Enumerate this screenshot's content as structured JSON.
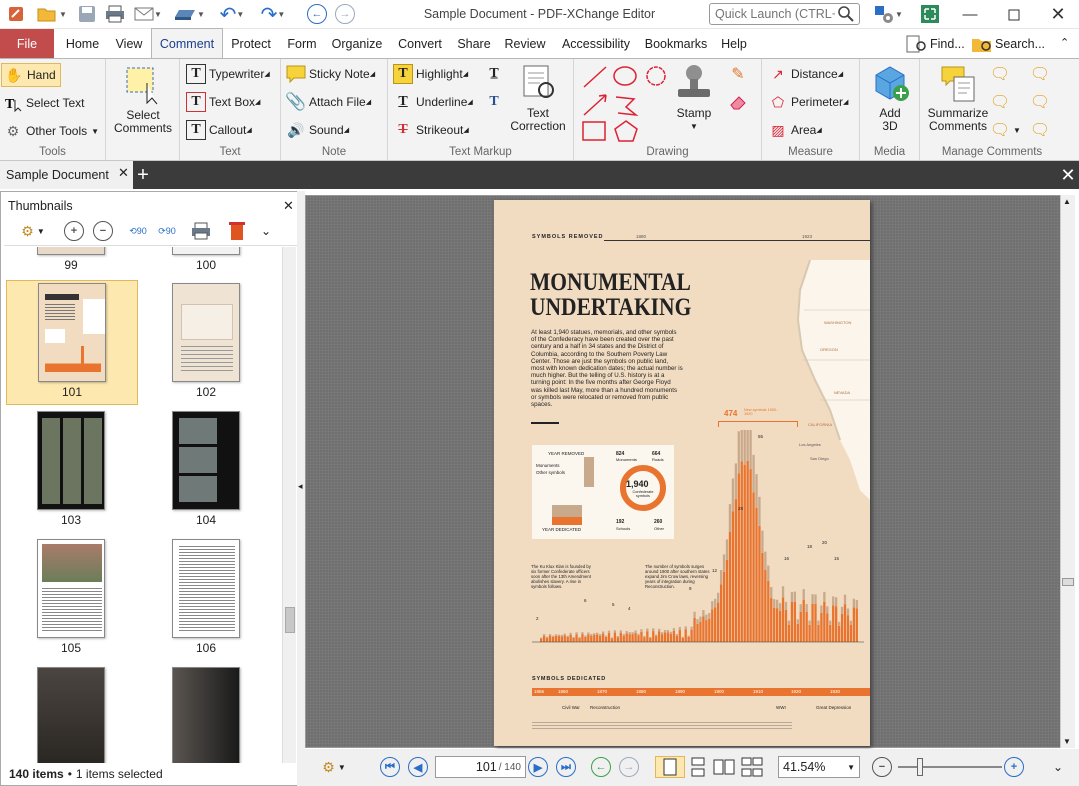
{
  "window": {
    "title": "Sample Document - PDF-XChange Editor",
    "quick_launch_placeholder": "Quick Launch (CTRL+.)"
  },
  "menu": {
    "file": "File",
    "tabs": [
      "Home",
      "View",
      "Comment",
      "Protect",
      "Form",
      "Organize",
      "Convert",
      "Share",
      "Review",
      "Accessibility",
      "Bookmarks",
      "Help"
    ],
    "active_tab": "Comment",
    "find": "Find...",
    "search": "Search..."
  },
  "ribbon": {
    "tools": {
      "label": "Tools",
      "hand": "Hand",
      "select_text": "Select Text",
      "other_tools": "Other Tools"
    },
    "select_comments": {
      "line1": "Select",
      "line2": "Comments"
    },
    "text": {
      "label": "Text",
      "typewriter": "Typewriter",
      "text_box": "Text Box",
      "callout": "Callout"
    },
    "note": {
      "label": "Note",
      "sticky_note": "Sticky Note",
      "attach_file": "Attach File",
      "sound": "Sound"
    },
    "text_markup": {
      "label": "Text Markup",
      "highlight": "Highlight",
      "underline": "Underline",
      "strikeout": "Strikeout",
      "text_correction_1": "Text",
      "text_correction_2": "Correction"
    },
    "drawing": {
      "label": "Drawing",
      "stamp": "Stamp"
    },
    "measure": {
      "label": "Measure",
      "distance": "Distance",
      "perimeter": "Perimeter",
      "area": "Area"
    },
    "media": {
      "label": "Media",
      "add3d_1": "Add",
      "add3d_2": "3D"
    },
    "manage": {
      "label": "Manage Comments",
      "summarize_1": "Summarize",
      "summarize_2": "Comments"
    }
  },
  "doc_tab": {
    "label": "Sample Document"
  },
  "thumbnails": {
    "title": "Thumbnails",
    "status_count": "140 items",
    "status_sep": "•",
    "status_selected": "1 items selected",
    "pages": [
      "99",
      "100",
      "101",
      "102",
      "103",
      "104",
      "105",
      "106"
    ],
    "selected": "101"
  },
  "page_content": {
    "kicker": "SYMBOLS REMOVED",
    "year_a": "1880",
    "year_b": "1923",
    "headline_1": "MONUMENTAL",
    "headline_2": "UNDERTAKING",
    "body": "At least 1,940 statues, memorials, and other symbols of the Confederacy have been created over the past century and a half in 34 states and the District of Columbia, according to the Southern Poverty Law Center. Those are just the symbols on public land, most with known dedication dates; the actual number is much higher. But the telling of U.S. history is at a turning point: In the five months after George Floyd was killed last May, more than a hundred monuments or symbols were relocated or removed from public spaces.",
    "big_total": "1,940",
    "big_total_sub": "Confederate symbols",
    "legend_year_removed": "YEAR REMOVED",
    "legend_year_dedicated": "YEAR DEDICATED",
    "legend_monuments": "Monuments",
    "legend_other": "Other symbols",
    "stat_824": "824",
    "stat_824_l": "Monuments",
    "stat_664": "664",
    "stat_664_l": "Roads",
    "stat_192": "192",
    "stat_192_l": "Schools",
    "stat_260": "260",
    "stat_260_l": "Other",
    "callout_474": "474",
    "callout_474_l": "New symbols 1900-1920",
    "note_kkk": "The Ku Klux Klan is founded by six former Confederate officers soon after the 13th Amendment abolishes slavery. A rise in symbols follows.",
    "note_1900": "The number of symbols surges around 1900 after southern states expand Jim Crow laws, reversing years of integration during Reconstruction.",
    "symbols_dedicated": "SYMBOLS DEDICATED",
    "decades": [
      "1856",
      "1860",
      "1870",
      "1880",
      "1890",
      "1900",
      "1910",
      "1920",
      "1930"
    ],
    "eras": [
      "Civil War",
      "Reconstruction",
      "WWI",
      "Great Depression"
    ],
    "peak_labels": [
      "55",
      "28",
      "20",
      "18",
      "16",
      "15",
      "12",
      "9",
      "6",
      "5",
      "4",
      "2"
    ],
    "map_labels": [
      "WASHINGTON",
      "OREGON",
      "NEVADA",
      "CALIFORNIA",
      "Los Angeles",
      "San Diego"
    ]
  },
  "statusbar": {
    "current_page": "101",
    "total_pages": "/ 140",
    "zoom": "41.54%"
  },
  "chart_data": {
    "type": "bar",
    "title": "SYMBOLS DEDICATED",
    "categories": [
      "1856",
      "1860",
      "1870",
      "1880",
      "1890",
      "1900",
      "1910",
      "1920",
      "1930"
    ],
    "series": [
      {
        "name": "Monuments",
        "values": [
          1,
          2,
          3,
          4,
          5,
          6,
          9,
          12,
          28,
          55,
          20,
          16,
          15
        ]
      }
    ]
  },
  "colors": {
    "accent_file": "#c24b4b",
    "chart_orange": "#e8742f",
    "chart_tan": "#c9a98c",
    "page_bg": "#f1dcc2"
  }
}
